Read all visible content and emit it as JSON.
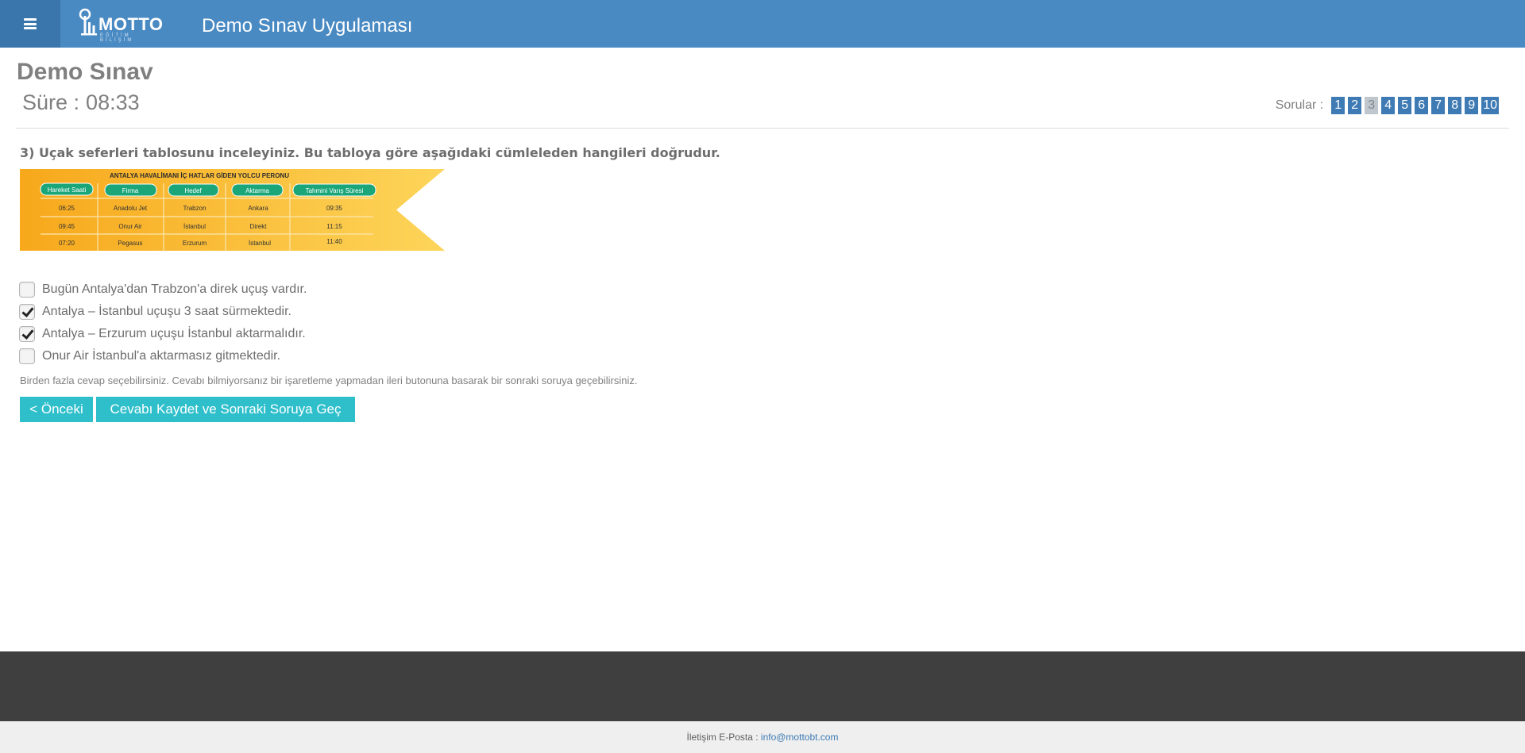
{
  "header": {
    "menu_icon": "hamburger-icon",
    "logo_text": "MOTTO",
    "logo_subtext": "EĞİTİM BİLİŞİM",
    "app_title": "Demo Sınav Uygulaması"
  },
  "exam": {
    "title": "Demo Sınav",
    "timer_label": "Süre :",
    "timer_value": "08:33"
  },
  "questions_nav": {
    "label": "Sorular :",
    "items": [
      "1",
      "2",
      "3",
      "4",
      "5",
      "6",
      "7",
      "8",
      "9",
      "10"
    ],
    "active": "3"
  },
  "question": {
    "text": "3) Uçak seferleri tablosunu inceleyiniz. Bu tabloya göre aşağıdaki cümleleden hangileri doğrudur."
  },
  "banner": {
    "title": "ANTALYA HAVALİMANI İÇ HATLAR GİDEN YOLCU PERONU",
    "headers": [
      "Hareket Saati",
      "Firma",
      "Hedef",
      "Aktarma",
      "Tahmini Varış Süresi"
    ],
    "rows": [
      [
        "06:25",
        "Anadolu Jet",
        "Trabzon",
        "Ankara",
        "09:35"
      ],
      [
        "09:45",
        "Onur Air",
        "İstanbul",
        "Direkt",
        "11:15"
      ],
      [
        "07:20",
        "Pegasus",
        "Erzurum",
        "İstanbul",
        "11:40"
      ]
    ],
    "colors": {
      "orange": "#f7a81b",
      "yellow": "#fdd55a",
      "pill": "#1aa679"
    }
  },
  "options": [
    {
      "label": "Bugün Antalya'dan Trabzon'a direk uçuş vardır.",
      "checked": false
    },
    {
      "label": "Antalya – İstanbul uçuşu 3 saat sürmektedir.",
      "checked": true
    },
    {
      "label": "Antalya – Erzurum uçuşu İstanbul aktarmalıdır.",
      "checked": true
    },
    {
      "label": "Onur Air İstanbul'a aktarmasız gitmektedir.",
      "checked": false
    }
  ],
  "hint": "Birden fazla cevap seçebilirsiniz. Cevabı bilmiyorsanız bir işaretleme yapmadan ileri butonuna basarak bir sonraki soruya geçebilirsiniz.",
  "buttons": {
    "prev": "< Önceki",
    "next": "Cevabı Kaydet ve Sonraki Soruya Geç >"
  },
  "footer": {
    "contact_label": "İletişim E-Posta :",
    "email": "info@mottobt.com"
  },
  "theme": {
    "header_bg": "#4a8ac3",
    "accent_button": "#2ebfcb",
    "question_nav": "#3e7ab3",
    "footer_dark": "#3f3f3f"
  }
}
